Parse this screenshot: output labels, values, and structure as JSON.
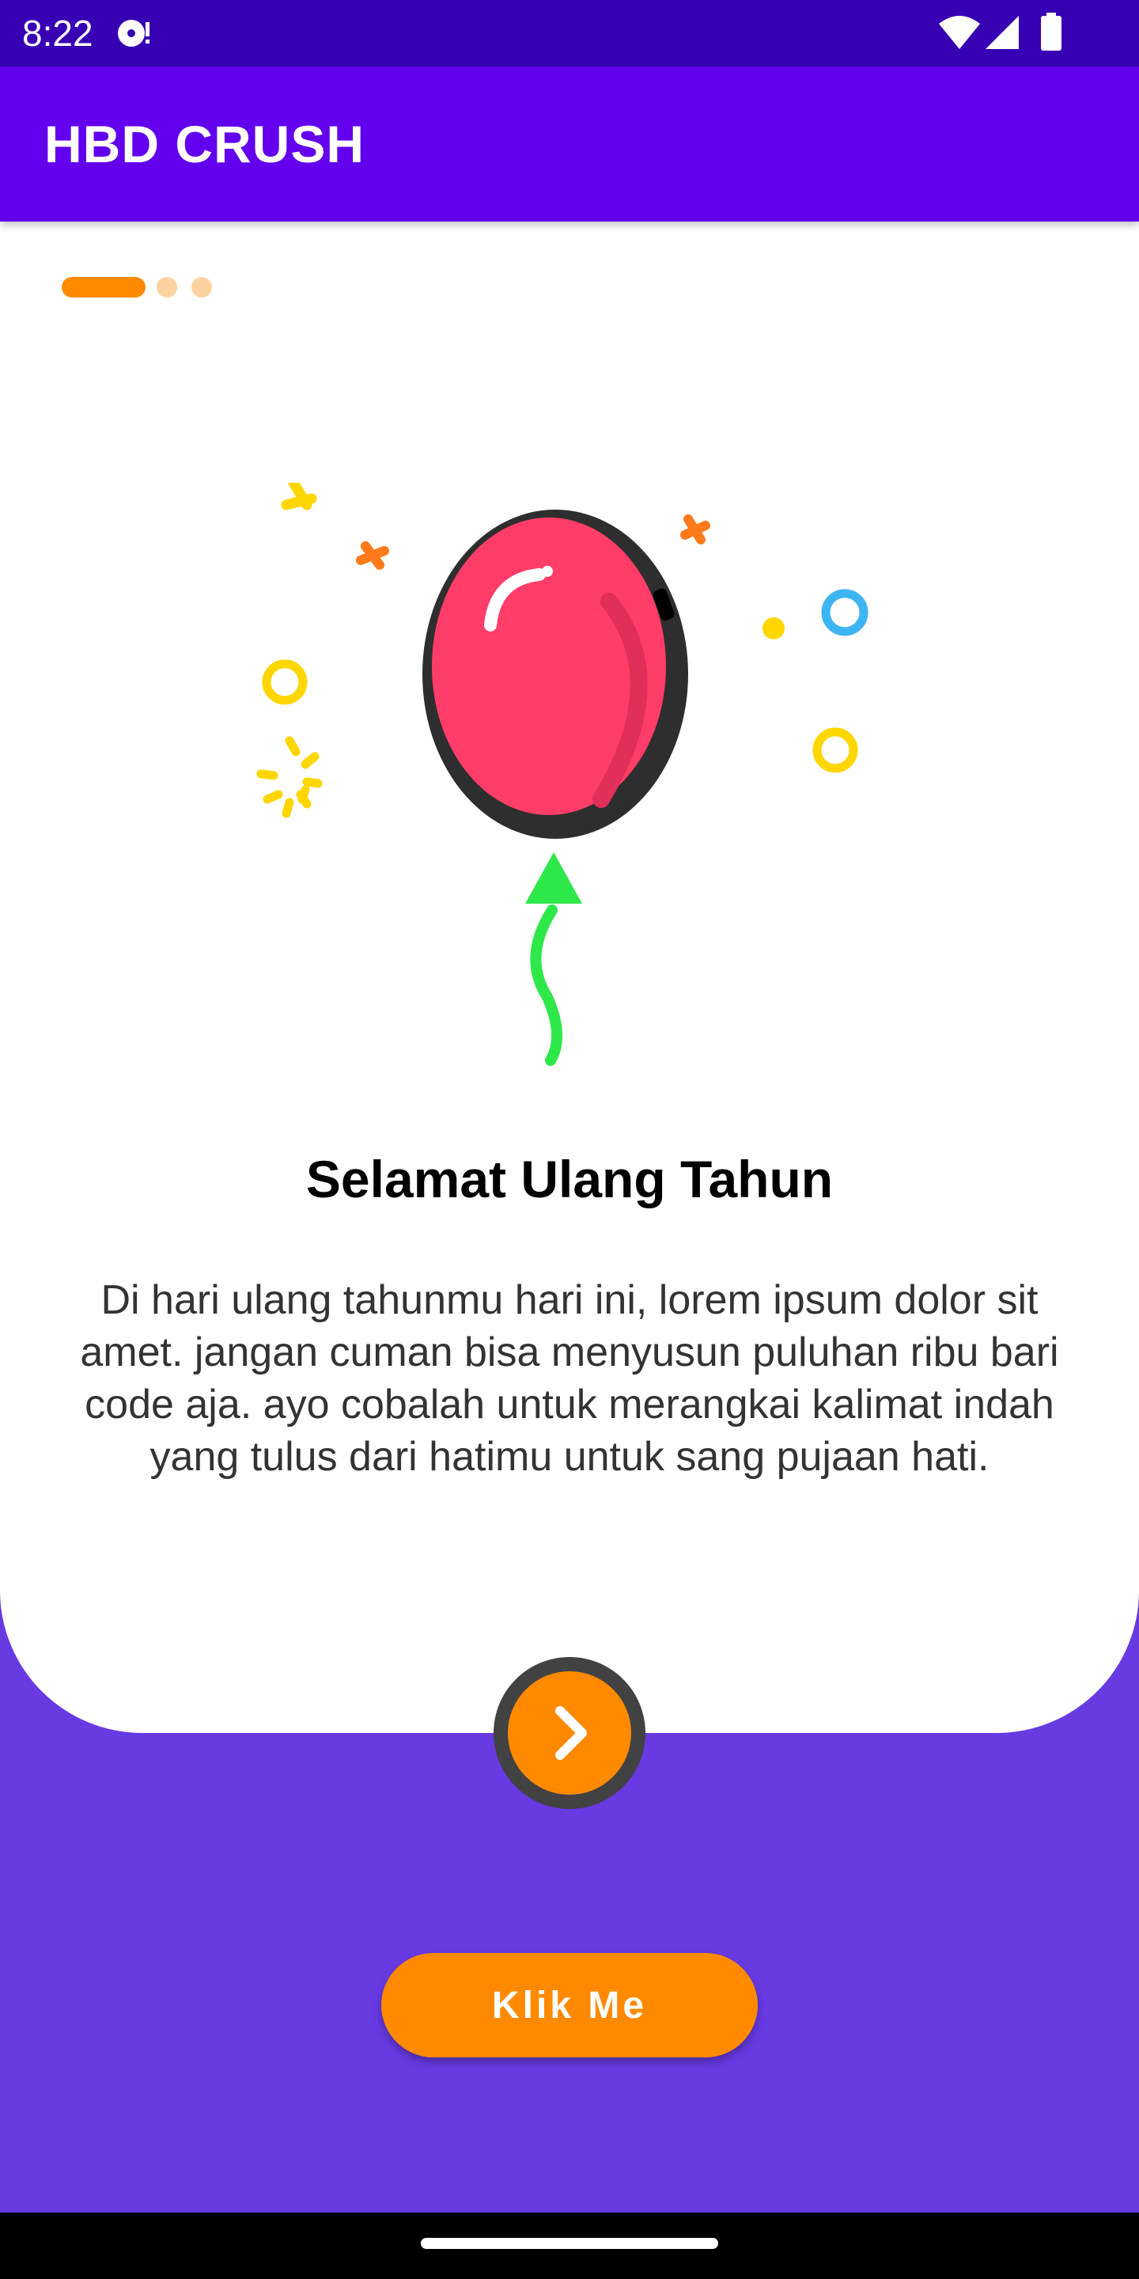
{
  "status_bar": {
    "time": "8:22",
    "icons": [
      "cast-icon",
      "wifi-icon",
      "signal-icon",
      "battery-icon"
    ]
  },
  "app_bar": {
    "title": "HBD CRUSH",
    "color": "#6200EE"
  },
  "onboarding": {
    "page_indicator": {
      "total": 3,
      "active_index": 0
    },
    "illustration": "balloon-icon",
    "title": "Selamat Ulang Tahun",
    "body": "Di hari ulang tahunmu hari ini, lorem ipsum dolor sit amet. jangan cuman bisa menyusun puluhan ribu bari code aja. ayo cobalah untuk merangkai kalimat indah yang tulus dari hatimu untuk sang pujaan hati.",
    "next_icon": "chevron-right-icon"
  },
  "actions": {
    "klik_label": "Klik Me"
  },
  "colors": {
    "accent": "#FF8A00",
    "background": "#673AE2",
    "balloon": "#FF3D68"
  }
}
